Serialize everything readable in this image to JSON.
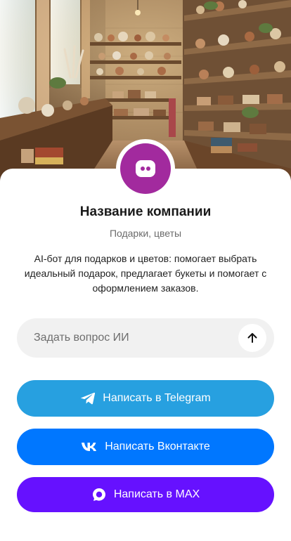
{
  "hero": {
    "image_icon": "gift-shop-interior-image"
  },
  "company": {
    "avatar_icon": "chat-bubble-icon",
    "avatar_color": "#a22a9e",
    "name": "Название компании",
    "category": "Подарки, цветы",
    "description": "AI-бот для подарков и цветов: помогает выбрать идеальный подарок, предлагает букеты и помогает с оформлением заказов."
  },
  "ask": {
    "placeholder": "Задать вопрос ИИ",
    "value": "",
    "send_icon": "arrow-up-icon"
  },
  "buttons": {
    "telegram": {
      "label": "Написать в Telegram",
      "icon": "telegram-icon",
      "color": "#27a0e0"
    },
    "vk": {
      "label": "Написать Вконтакте",
      "icon": "vk-icon",
      "color": "#0077ff"
    },
    "max": {
      "label": "Написать в MAX",
      "icon": "max-icon",
      "color": "#6611ff"
    }
  }
}
